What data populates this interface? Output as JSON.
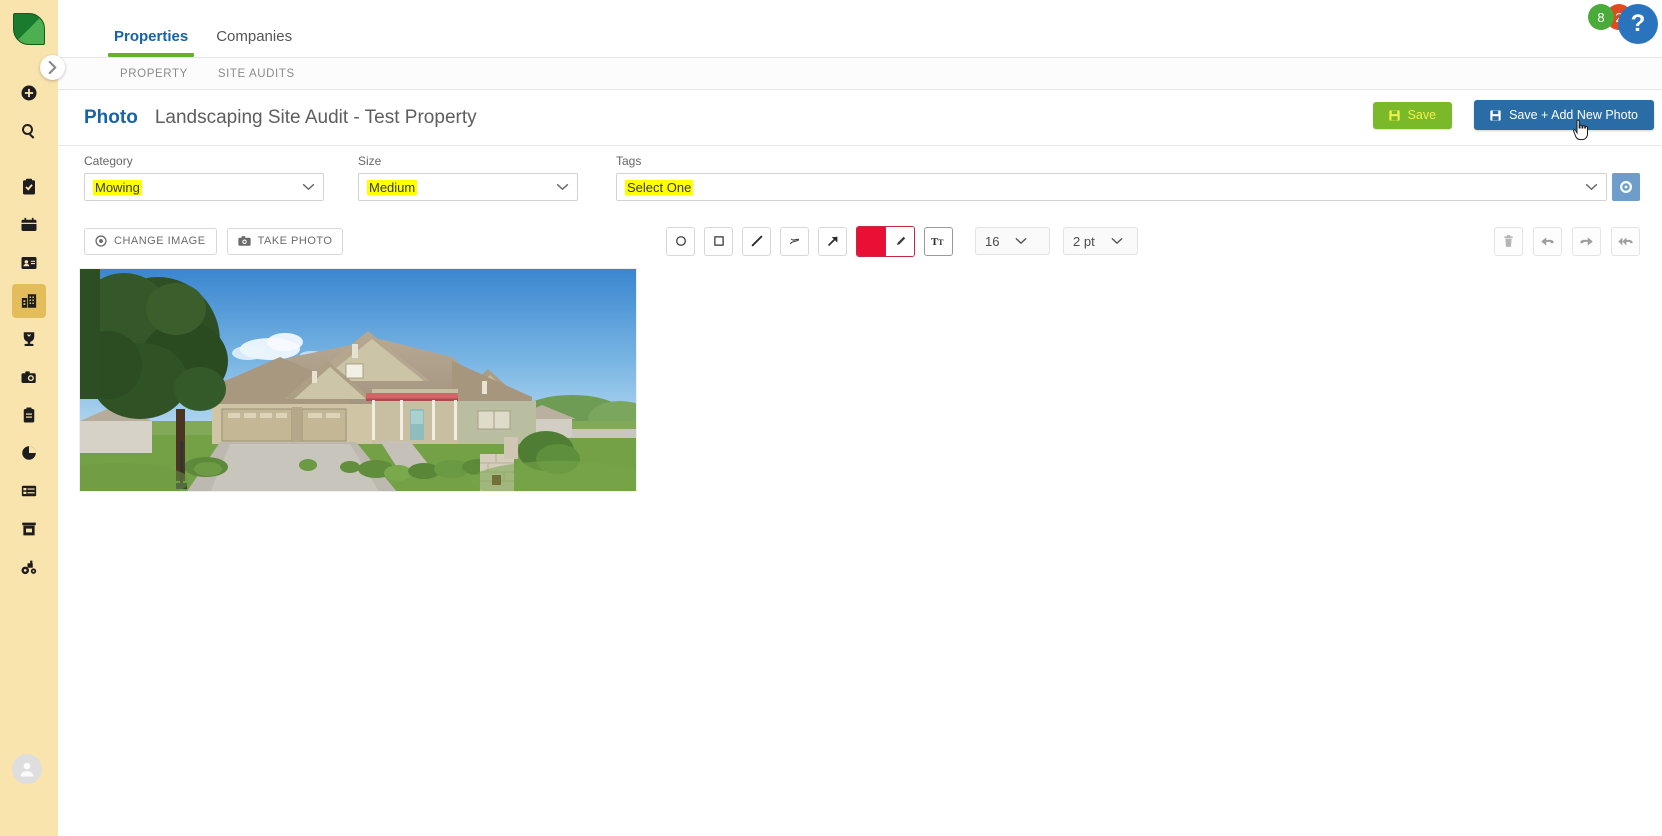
{
  "app": {
    "logo": "leaf-logo"
  },
  "sidebar": {
    "expander_icon": "chevron-right-icon",
    "items": [
      {
        "name": "add",
        "icon": "plus-circle-icon"
      },
      {
        "name": "search",
        "icon": "magnifier-icon"
      },
      {
        "name": "tasks",
        "icon": "clipboard-check-icon"
      },
      {
        "name": "calendar",
        "icon": "calendar-icon"
      },
      {
        "name": "contacts",
        "icon": "contact-card-icon"
      },
      {
        "name": "properties",
        "icon": "building-icon",
        "active": true
      },
      {
        "name": "awards",
        "icon": "trophy-icon"
      },
      {
        "name": "photos",
        "icon": "camera-icon"
      },
      {
        "name": "clipboard",
        "icon": "clipboard-icon"
      },
      {
        "name": "reports",
        "icon": "pie-chart-icon"
      },
      {
        "name": "schedule",
        "icon": "list-grid-icon"
      },
      {
        "name": "inventory",
        "icon": "box-icon"
      },
      {
        "name": "equipment",
        "icon": "tractor-icon"
      }
    ],
    "avatar": "user-avatar-icon"
  },
  "topnav": {
    "tabs": [
      {
        "label": "Properties",
        "active": true
      },
      {
        "label": "Companies",
        "active": false
      }
    ],
    "badges": {
      "green_count": "8",
      "orange_count": "2",
      "help_glyph": "?"
    }
  },
  "subnav": {
    "items": [
      {
        "label": "PROPERTY"
      },
      {
        "label": "SITE AUDITS"
      }
    ]
  },
  "page_header": {
    "kind": "Photo",
    "title": "Landscaping Site Audit - Test Property",
    "save_label": "Save",
    "save_add_label": "Save + Add New Photo",
    "save_icon": "floppy-disk-icon",
    "save_add_icon": "floppy-disk-icon",
    "cursor": "hand-pointer-cursor"
  },
  "form": {
    "category": {
      "label": "Category",
      "value": "Mowing",
      "chevron": "chevron-down-icon"
    },
    "size": {
      "label": "Size",
      "value": "Medium",
      "chevron": "chevron-down-icon"
    },
    "tags": {
      "label": "Tags",
      "value": "Select One",
      "chevron": "chevron-down-icon",
      "settings_icon": "gear-circle-icon"
    }
  },
  "toolbar": {
    "change_image_label": "CHANGE IMAGE",
    "change_image_icon": "target-circle-icon",
    "take_photo_label": "TAKE PHOTO",
    "take_photo_icon": "camera-icon",
    "tools": [
      {
        "name": "circle-tool",
        "icon": "circle-outline-icon"
      },
      {
        "name": "rectangle-tool",
        "icon": "square-outline-icon"
      },
      {
        "name": "line-tool",
        "icon": "line-icon"
      },
      {
        "name": "scribble-tool",
        "icon": "squiggle-icon"
      },
      {
        "name": "arrow-tool",
        "icon": "arrow-up-right-icon"
      }
    ],
    "color": {
      "hex": "#ea0f35",
      "pen_icon": "pen-icon",
      "border_hex": "#c42a44"
    },
    "text_tool": {
      "name": "text-tool",
      "glyph": "Tt"
    },
    "font_size": {
      "value": "16",
      "chevron": "chevron-down-icon"
    },
    "stroke_width": {
      "value": "2 pt",
      "chevron": "chevron-down-icon"
    },
    "right_tools": [
      {
        "name": "delete-tool",
        "icon": "trash-icon"
      },
      {
        "name": "undo-tool",
        "icon": "arrow-back-icon"
      },
      {
        "name": "redo-tool",
        "icon": "arrow-forward-icon"
      },
      {
        "name": "reset-all-tool",
        "icon": "double-arrow-back-icon"
      }
    ]
  },
  "photo": {
    "alt": "suburban-house-exterior-photo",
    "colors": {
      "sky_top": "#3d8fd4",
      "sky_bottom": "#a8d3ef",
      "roof": "#ab9b87",
      "siding_tan": "#cfc4a4",
      "siding_green": "#b9bea0",
      "grass": "#6f9c42",
      "driveway": "#b9b5ad",
      "tree": "#2c4a22"
    }
  }
}
